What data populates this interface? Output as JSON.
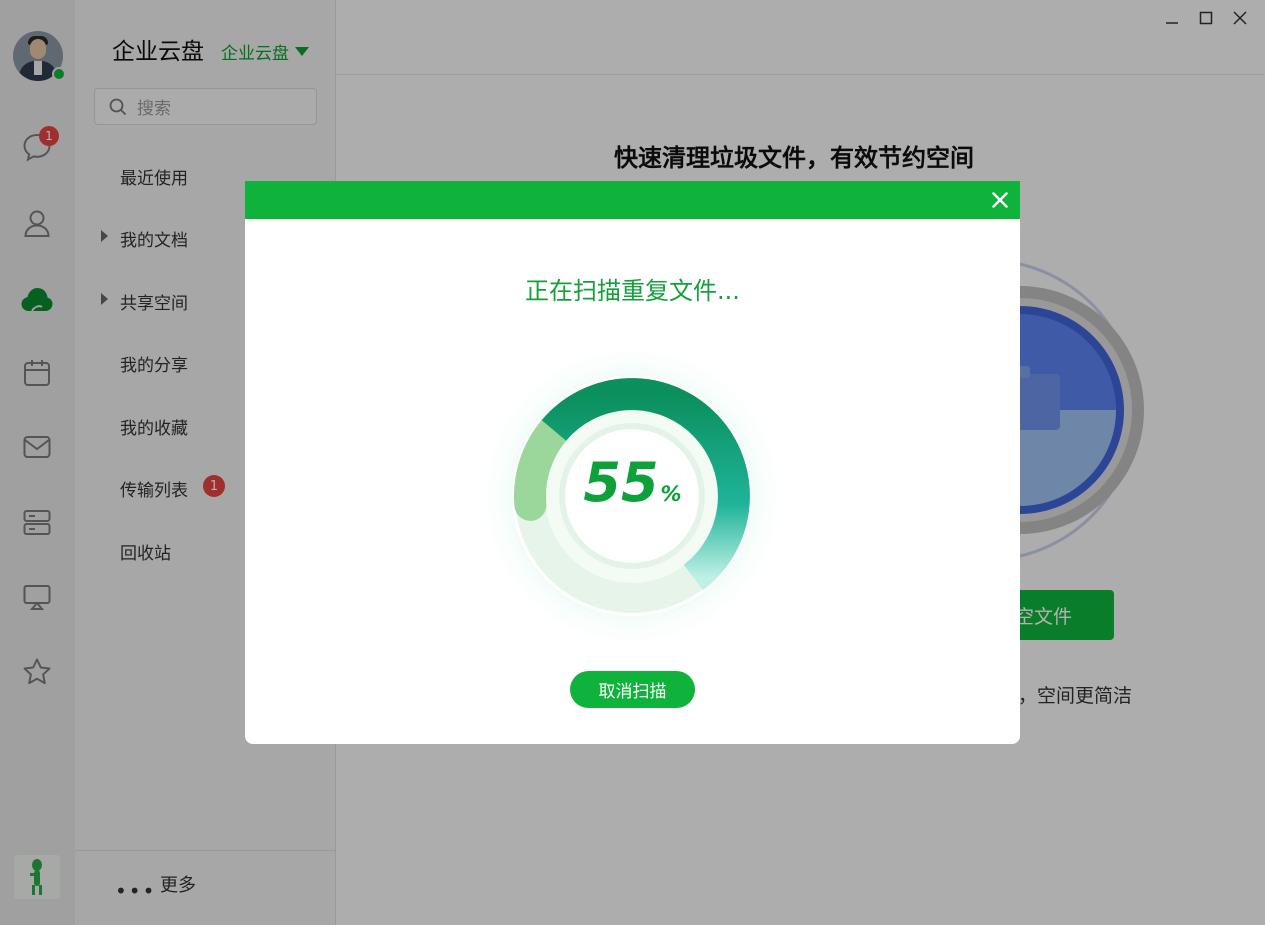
{
  "app": {
    "title": "企业云盘",
    "space_selector": "企业云盘"
  },
  "rail": {
    "messages_badge": "1",
    "items": [
      "chat-icon",
      "contacts-icon",
      "cloud-icon",
      "calendar-icon",
      "mail-icon",
      "storage-icon",
      "screen-icon",
      "favorites-icon"
    ]
  },
  "sidebar": {
    "search_placeholder": "搜索",
    "items": [
      {
        "label": "最近使用"
      },
      {
        "label": "我的文档"
      },
      {
        "label": "共享空间"
      },
      {
        "label": "我的分享"
      },
      {
        "label": "我的收藏"
      },
      {
        "label": "传输列表",
        "badge": "1"
      },
      {
        "label": "回收站"
      }
    ],
    "more_label": "更多"
  },
  "main": {
    "hero_title": "快速清理垃圾文件，有效节约空间",
    "button_partial": "空文件",
    "note_partial": "，空间更简洁"
  },
  "modal": {
    "scan_title": "正在扫描重复文件...",
    "progress": 55,
    "progress_text": "55",
    "progress_unit": "%",
    "cancel_label": "取消扫描"
  },
  "colors": {
    "brand_green": "#0fb33b",
    "badge_red": "#e64340"
  }
}
